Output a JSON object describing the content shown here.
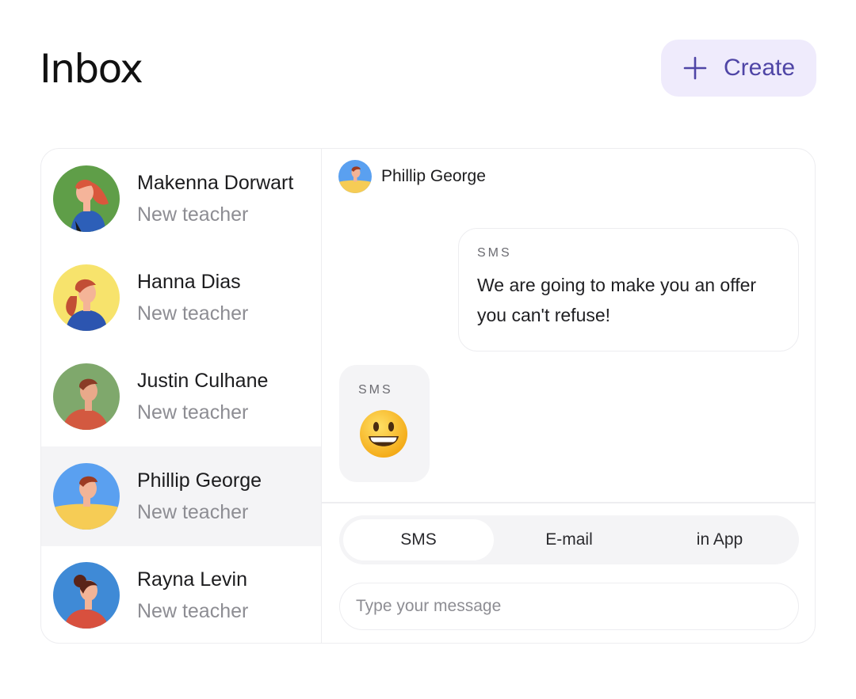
{
  "header": {
    "title": "Inbox",
    "create_label": "Create"
  },
  "contacts": [
    {
      "name": "Makenna Dorwart",
      "role": "New teacher",
      "avatar_bg": "#5f9e48",
      "active": false
    },
    {
      "name": "Hanna Dias",
      "role": "New teacher",
      "avatar_bg": "#f7e36c",
      "active": false
    },
    {
      "name": "Justin Culhane",
      "role": "New teacher",
      "avatar_bg": "#7fa86c",
      "active": false
    },
    {
      "name": "Phillip George",
      "role": "New teacher",
      "avatar_bg": "#5aa0f0",
      "active": true
    },
    {
      "name": "Rayna Levin",
      "role": "New teacher",
      "avatar_bg": "#3f8ad6",
      "active": false
    }
  ],
  "conversation": {
    "contact_name": "Phillip George",
    "messages": [
      {
        "direction": "outgoing",
        "channel": "SMS",
        "text": "We are going to make you an offer you can't refuse!"
      },
      {
        "direction": "incoming",
        "channel": "SMS",
        "emoji": "grinning-face"
      }
    ],
    "channels": [
      "SMS",
      "E-mail",
      "in App"
    ],
    "selected_channel": "SMS",
    "input": {
      "value": "",
      "placeholder": "Type your message"
    }
  },
  "colors": {
    "accent": "#4f45a6",
    "accent_bg": "#efebfc",
    "muted_text": "#8d8d93",
    "selected_row": "#f4f4f6",
    "border": "#ededf0"
  },
  "icons": {
    "create": "plus-icon",
    "emoji": "grinning-face-emoji"
  }
}
